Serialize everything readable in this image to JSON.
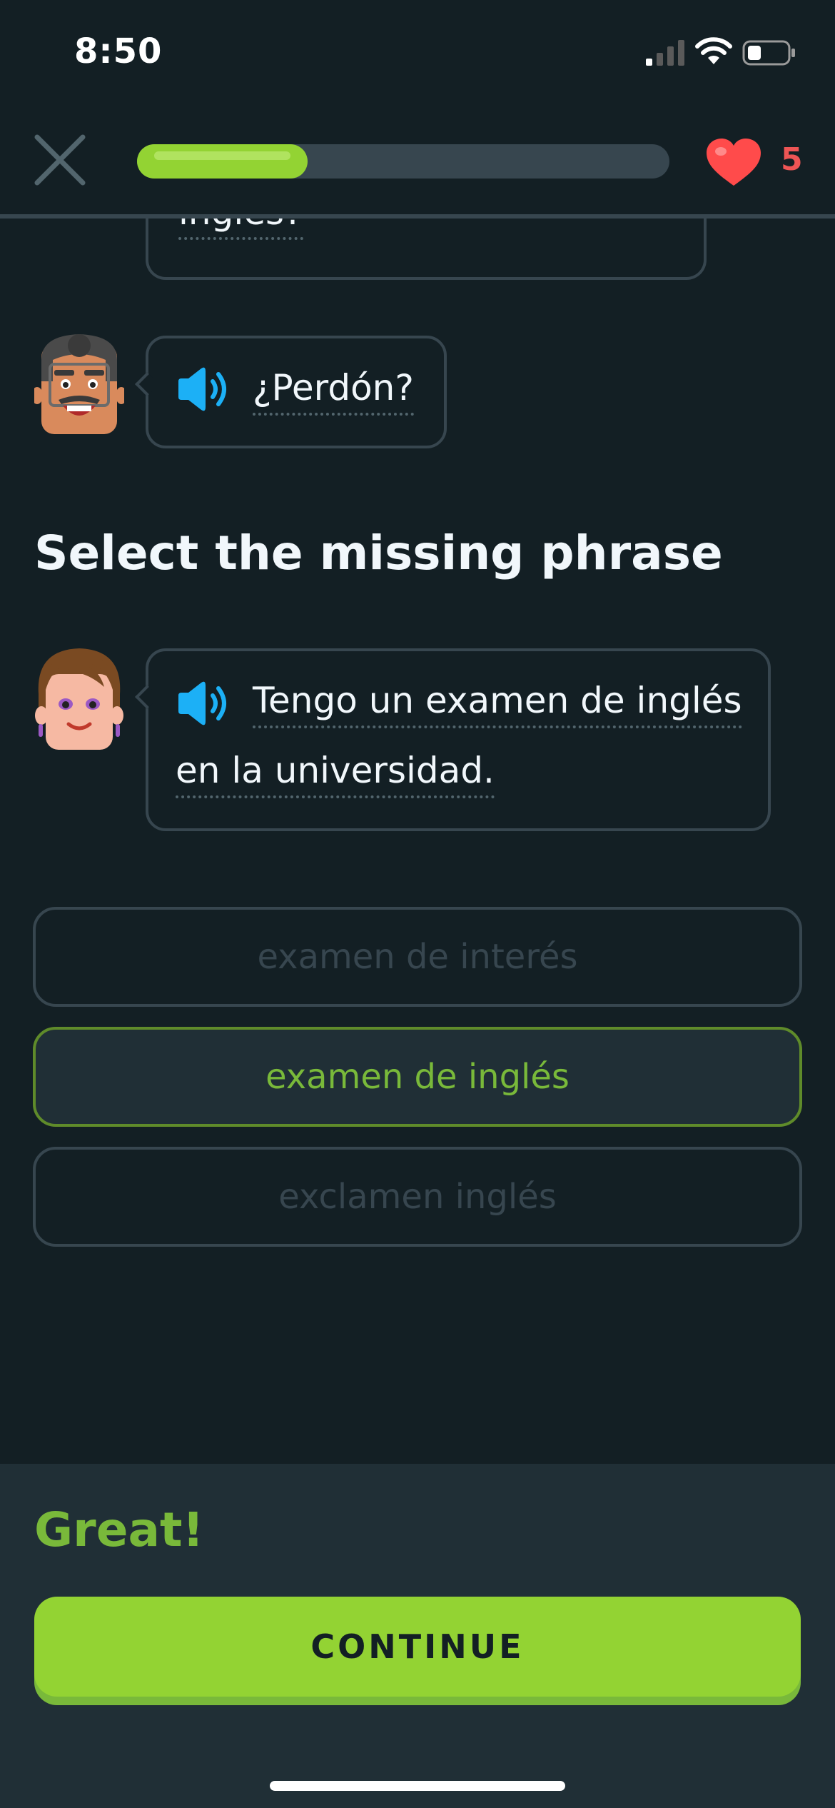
{
  "status_bar": {
    "time": "8:50"
  },
  "header": {
    "hearts": "5",
    "progress_fraction": 0.32
  },
  "conversation": {
    "top_fragment": "inglés?",
    "man_line": "¿Perdón?",
    "prompt": "Select the missing phrase",
    "woman_line_1": "Tengo un examen de inglés",
    "woman_line_2": "en la universidad."
  },
  "options": [
    {
      "label": "examen de interés",
      "selected": false
    },
    {
      "label": "examen de inglés",
      "selected": true
    },
    {
      "label": "exclamen inglés",
      "selected": false
    }
  ],
  "footer": {
    "feedback": "Great!",
    "continue_label": "CONTINUE"
  },
  "colors": {
    "background": "#131f24",
    "accent_green": "#93d333",
    "feedback_green": "#79b93a",
    "heart_red": "#ff4b4b",
    "speaker_blue": "#1cb0f6"
  },
  "icons": [
    "close-icon",
    "heart-icon",
    "speaker-icon",
    "signal-icon",
    "wifi-icon",
    "battery-icon"
  ]
}
